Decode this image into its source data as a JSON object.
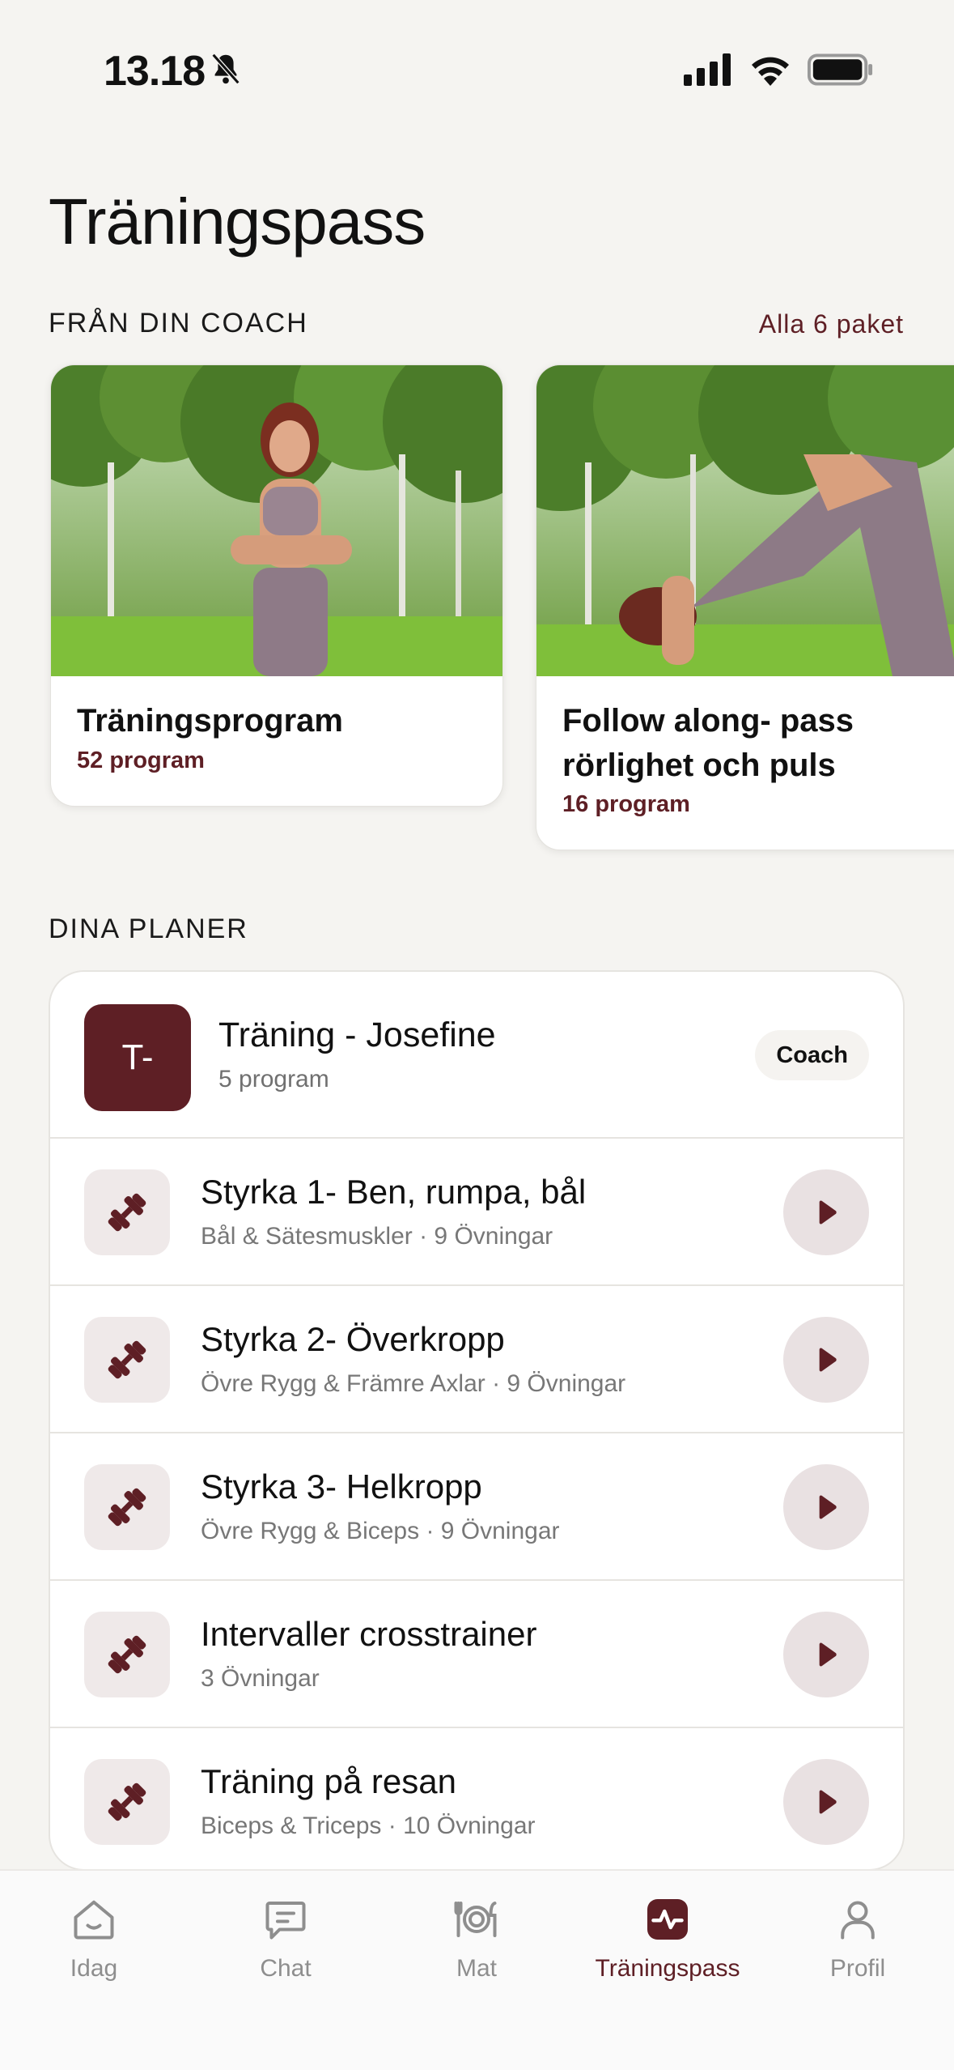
{
  "status_bar": {
    "time": "13.18"
  },
  "page": {
    "title": "Träningspass"
  },
  "coach_section": {
    "title": "FRÅN DIN COACH",
    "link": "Alla 6 paket",
    "cards": [
      {
        "title": "Träningsprogram",
        "count": "52 program"
      },
      {
        "title": "Follow along- pass rörlighet och puls",
        "count": "16 program"
      }
    ]
  },
  "plans_section": {
    "title": "DINA PLANER",
    "header": {
      "avatar": "T-",
      "name": "Träning - Josefine",
      "sub": "5 program",
      "badge": "Coach"
    },
    "items": [
      {
        "title": "Styrka 1- Ben, rumpa, bål",
        "sub": "Bål & Sätesmuskler · 9 Övningar"
      },
      {
        "title": "Styrka 2- Överkropp",
        "sub": "Övre Rygg & Främre Axlar · 9 Övningar"
      },
      {
        "title": "Styrka 3- Helkropp",
        "sub": "Övre Rygg & Biceps · 9 Övningar"
      },
      {
        "title": "Intervaller crosstrainer",
        "sub": "3 Övningar"
      },
      {
        "title": "Träning på resan",
        "sub": "Biceps & Triceps · 10 Övningar"
      }
    ]
  },
  "tabbar": {
    "tabs": [
      {
        "label": "Idag",
        "icon": "home-icon"
      },
      {
        "label": "Chat",
        "icon": "chat-icon"
      },
      {
        "label": "Mat",
        "icon": "plate-icon"
      },
      {
        "label": "Träningspass",
        "icon": "activity-icon",
        "active": true
      },
      {
        "label": "Profil",
        "icon": "person-icon"
      }
    ]
  },
  "colors": {
    "accent": "#5e1f25",
    "background": "#f5f4f1"
  }
}
